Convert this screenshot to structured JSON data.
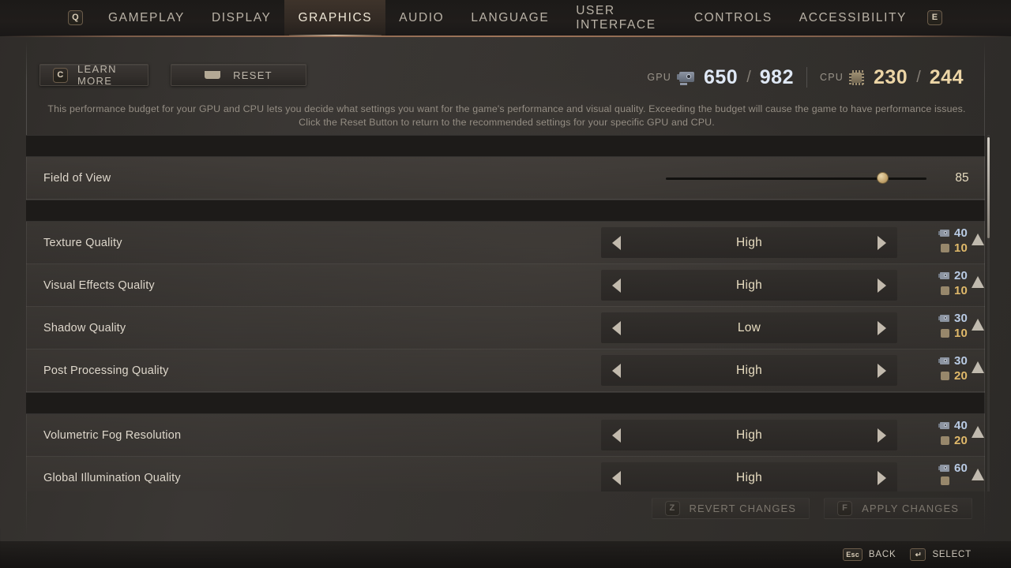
{
  "nav": {
    "left_key": "Q",
    "right_key": "E",
    "tabs": [
      {
        "label": "GAMEPLAY",
        "active": false
      },
      {
        "label": "DISPLAY",
        "active": false
      },
      {
        "label": "GRAPHICS",
        "active": true
      },
      {
        "label": "AUDIO",
        "active": false
      },
      {
        "label": "LANGUAGE",
        "active": false
      },
      {
        "label": "USER INTERFACE",
        "active": false
      },
      {
        "label": "CONTROLS",
        "active": false
      },
      {
        "label": "ACCESSIBILITY",
        "active": false
      }
    ]
  },
  "toolbar": {
    "learn_more_key": "C",
    "learn_more_label": "LEARN MORE",
    "reset_key": "spacebar-icon",
    "reset_label": "RESET"
  },
  "budget": {
    "gpu_label": "GPU",
    "gpu_used": "650",
    "gpu_separator": "/",
    "gpu_total": "982",
    "cpu_label": "CPU",
    "cpu_used": "230",
    "cpu_separator": "/",
    "cpu_total": "244",
    "gpu_color": "#dfe8f5",
    "cpu_color": "#ecd5a6"
  },
  "description": "This performance budget for your GPU and CPU lets you decide what settings you want for the game's performance and visual quality. Exceeding the budget will cause the game to have performance issues. Click the Reset Button to return to the recommended settings for your specific GPU and CPU.",
  "settings": {
    "fov": {
      "label": "Field of View",
      "value": "85",
      "slider_percent": 83
    },
    "rows": [
      {
        "label": "Texture Quality",
        "value": "High",
        "gpu_cost": "40",
        "cpu_cost": "10"
      },
      {
        "label": "Visual Effects Quality",
        "value": "High",
        "gpu_cost": "20",
        "cpu_cost": "10"
      },
      {
        "label": "Shadow Quality",
        "value": "Low",
        "gpu_cost": "30",
        "cpu_cost": "10"
      },
      {
        "label": "Post Processing Quality",
        "value": "High",
        "gpu_cost": "30",
        "cpu_cost": "20"
      }
    ],
    "rows2": [
      {
        "label": "Volumetric Fog Resolution",
        "value": "High",
        "gpu_cost": "40",
        "cpu_cost": "20"
      },
      {
        "label": "Global Illumination Quality",
        "value": "High",
        "gpu_cost": "60",
        "cpu_cost": ""
      }
    ]
  },
  "actions": {
    "revert_key": "Z",
    "revert_label": "REVERT CHANGES",
    "apply_key": "F",
    "apply_label": "APPLY CHANGES"
  },
  "footer": {
    "back_key": "Esc",
    "back_label": "BACK",
    "select_key": "↵",
    "select_label": "SELECT"
  }
}
